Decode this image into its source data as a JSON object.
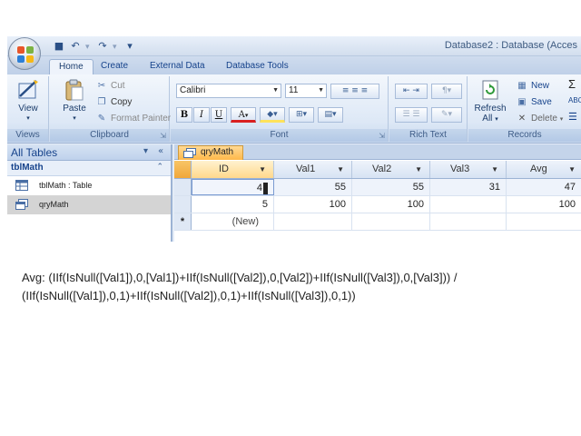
{
  "window": {
    "title": "Database2 : Database (Acces"
  },
  "quick_access": {
    "save_icon": "save-icon",
    "undo_icon": "undo-icon",
    "redo_icon": "redo-icon",
    "customize_icon": "dropdown-icon"
  },
  "ribbon_tabs": [
    {
      "label": "Home",
      "active": true
    },
    {
      "label": "Create",
      "active": false
    },
    {
      "label": "External Data",
      "active": false
    },
    {
      "label": "Database Tools",
      "active": false
    }
  ],
  "ribbon": {
    "views": {
      "label": "Views",
      "view_button": "View"
    },
    "clipboard": {
      "label": "Clipboard",
      "paste": "Paste",
      "cut": "Cut",
      "copy": "Copy",
      "format_painter": "Format Painter"
    },
    "font": {
      "label": "Font",
      "font_name": "Calibri",
      "font_size": "11",
      "bold": "B",
      "italic": "I",
      "underline": "U",
      "font_color": "A"
    },
    "rich_text": {
      "label": "Rich Text"
    },
    "records": {
      "label": "Records",
      "refresh": "Refresh",
      "refresh_sub": "All",
      "new": "New",
      "save": "Save",
      "delete": "Delete"
    }
  },
  "nav_pane": {
    "header": "All Tables",
    "group": "tblMath",
    "items": [
      {
        "label": "tblMath : Table",
        "icon": "table-icon",
        "selected": false
      },
      {
        "label": "qryMath",
        "icon": "query-icon",
        "selected": true
      }
    ]
  },
  "document": {
    "tab_label": "qryMath",
    "columns": [
      "ID",
      "Val1",
      "Val2",
      "Val3",
      "Avg"
    ],
    "rows": [
      {
        "ID": "4",
        "Val1": "55",
        "Val2": "55",
        "Val3": "31",
        "Avg": "47"
      },
      {
        "ID": "5",
        "Val1": "100",
        "Val2": "100",
        "Val3": "",
        "Avg": "100"
      }
    ],
    "new_row_marker": "*",
    "new_row_label": "(New)"
  },
  "formula": {
    "line1": "Avg: (IIf(IsNull([Val1]),0,[Val1])+IIf(IsNull([Val2]),0,[Val2])+IIf(IsNull([Val3]),0,[Val3])) /",
    "line2": "(IIf(IsNull([Val1]),0,1)+IIf(IsNull([Val2]),0,1)+IIf(IsNull([Val3]),0,1))"
  },
  "colors": {
    "ribbon_blue": "#15428b",
    "tab_orange": "#ffb84a",
    "header_bg": "#d7e3f3"
  }
}
